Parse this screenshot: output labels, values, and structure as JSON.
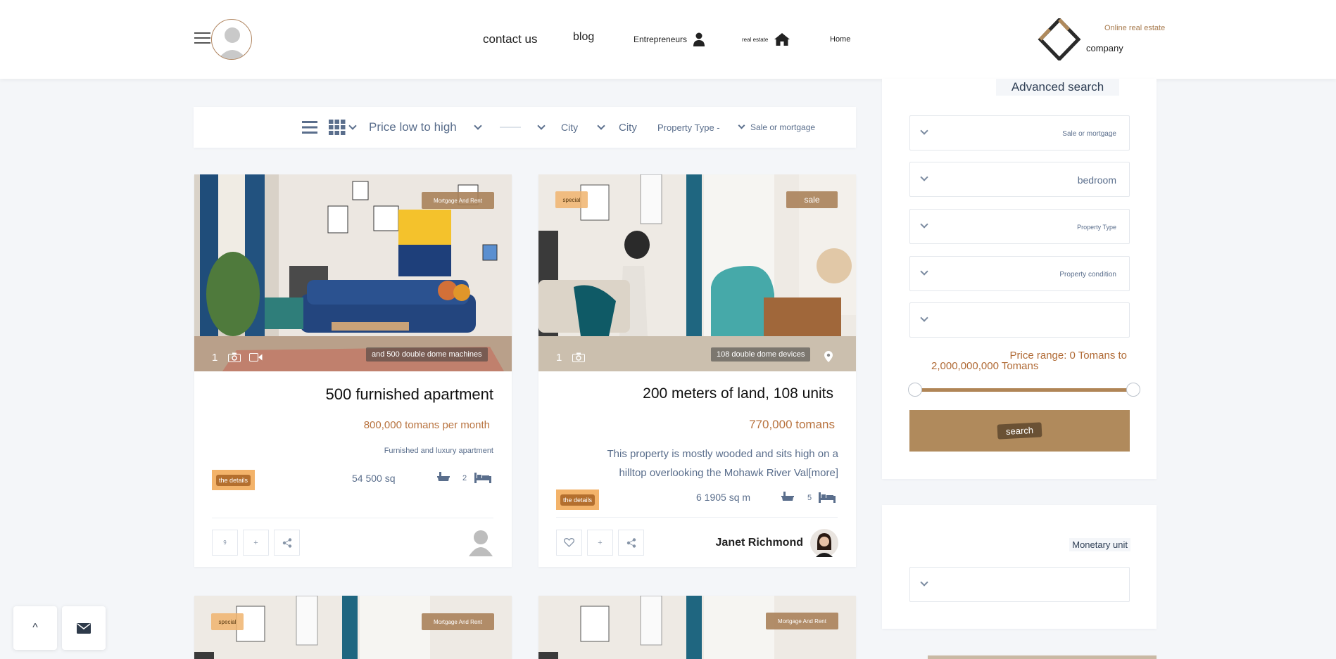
{
  "header": {
    "nav": {
      "contact": "contact us",
      "blog": "blog",
      "entrepreneurs": "Entrepreneurs",
      "real_estate": "real estate",
      "home": "Home"
    },
    "logo": {
      "online": "Online real estate",
      "company": "company"
    }
  },
  "toolbar": {
    "sort": "Price low to high",
    "city_1": "City",
    "city_2": "City",
    "property_type": "Property Type -",
    "sale_or_mortgage": "Sale or mortgage"
  },
  "listings": [
    {
      "badge_right": "Mortgage And Rent",
      "photo_count": "1",
      "caption": "and 500 double dome machines",
      "title": "500 furnished apartment",
      "price": "800,000 tomans per month",
      "subtitle": "Furnished and luxury apartment",
      "details_label": "the details",
      "area": "54 500 sq",
      "bedrooms": "2",
      "like_count": "9",
      "compare": "+"
    },
    {
      "badge_left": "special",
      "badge_right": "sale",
      "photo_count": "1",
      "caption": "108 double dome devices",
      "title": "200 meters of land, 108 units",
      "price": "770,000 tomans",
      "description": "This property is mostly wooded and sits high on a hilltop overlooking the Mohawk River Val",
      "more": "[more]",
      "details_label": "the details",
      "area": "6 1905 sq m",
      "bedrooms": "5",
      "compare": "+",
      "agent": "Janet Richmond"
    },
    {
      "badge_left": "special",
      "badge_right": "Mortgage And Rent"
    },
    {
      "badge_right": "Mortgage And Rent"
    }
  ],
  "sidebar": {
    "title": "Advanced search",
    "selects": [
      "Sale or mortgage",
      "bedroom",
      "Property Type",
      "Property condition",
      ""
    ],
    "price_range_line1": "Price range: 0 Tomans to",
    "price_range_line2": "2,000,000,000 Tomans",
    "price_range": {
      "min": 0,
      "max": 2000000000,
      "selected_min_fraction": 0,
      "selected_max_fraction": 1
    },
    "search_button": "search",
    "monetary_unit": "Monetary unit"
  },
  "float": {
    "top": "^"
  },
  "colors": {
    "accent": "#b08a5c",
    "price": "#b8733f",
    "special": "#f3b36a",
    "text_muted": "#5a6e8c"
  }
}
